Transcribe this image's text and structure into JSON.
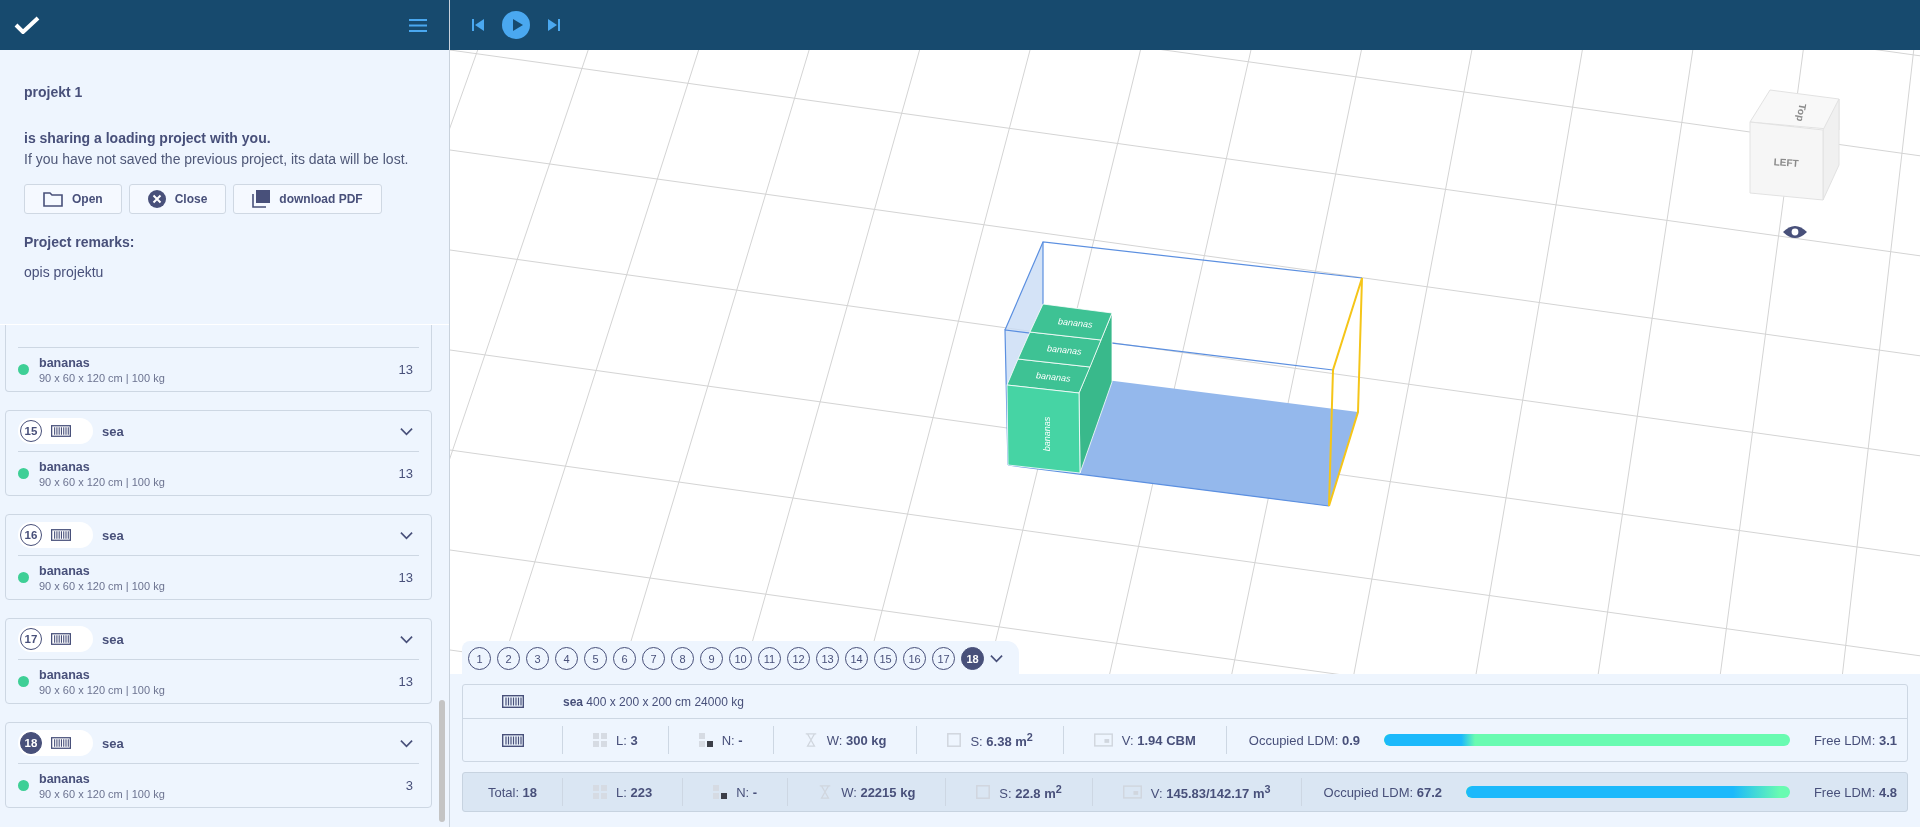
{
  "notice": {
    "project": "projekt 1",
    "message": "is sharing a loading project with you.",
    "warning": "If you have not saved the previous project, its data will be lost.",
    "buttons": [
      {
        "kind": "open",
        "label": "Open"
      },
      {
        "kind": "close",
        "label": "Close"
      },
      {
        "kind": "pdf",
        "label": "download PDF"
      }
    ],
    "remarks_label": "Project remarks:",
    "remarks": "opis projektu"
  },
  "containers": [
    {
      "cargo": {
        "name": "bananas",
        "color": "#3ecf96",
        "size": "90 x 60 x 120 cm | 100 kg",
        "count": "13"
      }
    },
    {
      "number": "15",
      "name": "sea",
      "selected": false,
      "cargo": {
        "name": "bananas",
        "color": "#3ecf96",
        "size": "90 x 60 x 120 cm | 100 kg",
        "count": "13"
      }
    },
    {
      "number": "16",
      "name": "sea",
      "selected": false,
      "cargo": {
        "name": "bananas",
        "color": "#3ecf96",
        "size": "90 x 60 x 120 cm | 100 kg",
        "count": "13"
      }
    },
    {
      "number": "17",
      "name": "sea",
      "selected": false,
      "cargo": {
        "name": "bananas",
        "color": "#3ecf96",
        "size": "90 x 60 x 120 cm | 100 kg",
        "count": "13"
      }
    },
    {
      "number": "18",
      "name": "sea",
      "selected": true,
      "cargo": {
        "name": "bananas",
        "color": "#3ecf96",
        "size": "90 x 60 x 120 cm | 100 kg",
        "count": "3"
      }
    }
  ],
  "scene": {
    "box_labels": [
      "bananas",
      "bananas",
      "bananas",
      "bananas"
    ],
    "view_cube": {
      "front": "LEFT",
      "top": "Top"
    }
  },
  "container_tabs": [
    {
      "label": "1",
      "selected": false
    },
    {
      "label": "2",
      "selected": false
    },
    {
      "label": "3",
      "selected": false
    },
    {
      "label": "4",
      "selected": false
    },
    {
      "label": "5",
      "selected": false
    },
    {
      "label": "6",
      "selected": false
    },
    {
      "label": "7",
      "selected": false
    },
    {
      "label": "8",
      "selected": false
    },
    {
      "label": "9",
      "selected": false
    },
    {
      "label": "10",
      "selected": false
    },
    {
      "label": "11",
      "selected": false
    },
    {
      "label": "12",
      "selected": false
    },
    {
      "label": "13",
      "selected": false
    },
    {
      "label": "14",
      "selected": false
    },
    {
      "label": "15",
      "selected": false
    },
    {
      "label": "16",
      "selected": false
    },
    {
      "label": "17",
      "selected": false
    },
    {
      "label": "18",
      "selected": true
    }
  ],
  "container_info": {
    "name": "sea",
    "spec": "400 x 200 x 200 cm 24000 kg"
  },
  "container_stats": {
    "stats": [
      {
        "kind": "layers",
        "label": "L:",
        "value": "3"
      },
      {
        "kind": "stack",
        "label": "N:",
        "value": "-"
      },
      {
        "kind": "weight",
        "label": "W:",
        "value": "300 kg"
      },
      {
        "kind": "area",
        "label": "S:",
        "value": "6.38 m$^{2}$"
      },
      {
        "kind": "volume",
        "label": "V:",
        "value": "1.94 CBM"
      }
    ],
    "occupied_label": "Occupied LDM:",
    "occupied": "0.9",
    "level": 0.225,
    "free_label": "Free LDM:",
    "free": "3.1"
  },
  "totals": {
    "total_label": "Total:",
    "total": "18",
    "stats": [
      {
        "kind": "layers",
        "label": "L:",
        "value": "223"
      },
      {
        "kind": "stack",
        "label": "N:",
        "value": "-"
      },
      {
        "kind": "weight",
        "label": "W:",
        "value": "22215 kg"
      },
      {
        "kind": "area",
        "label": "S:",
        "value": "22.8 m$^{2}$"
      },
      {
        "kind": "volume",
        "label": "V:",
        "value": "145.83/142.17 m$^{3}$"
      }
    ],
    "occupied_label": "Occupied LDM:",
    "occupied": "67.2",
    "level": 0.97,
    "free_label": "Free LDM:",
    "free": "4.8"
  }
}
